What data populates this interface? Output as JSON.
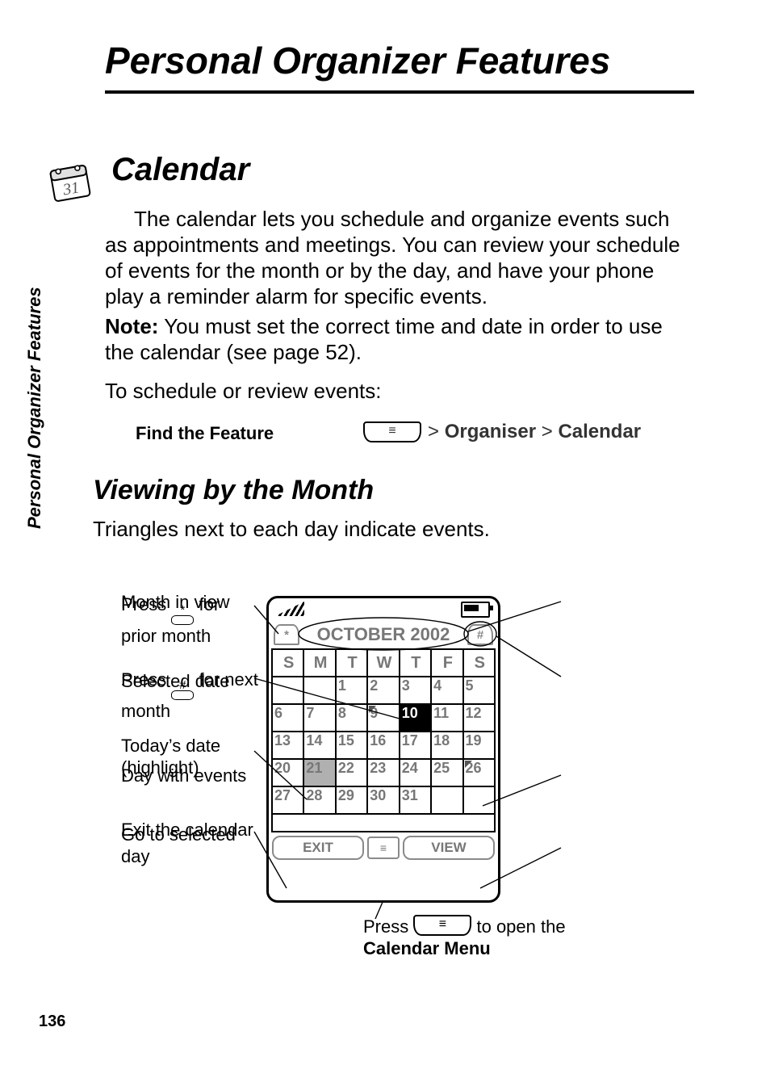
{
  "page": {
    "title": "Personal Organizer Features",
    "side_tab": "Personal Organizer Features",
    "page_number": "136"
  },
  "sections": {
    "calendar_heading": "Calendar",
    "intro": "The calendar lets you schedule and organize events such as appointments and meetings. You can review your schedule of events for the month or by the day, and have your phone play a reminder alarm for specific events.",
    "note_label": "Note:",
    "note_text": " You must set the correct time and date in order to use the calendar (see page 52).",
    "schedule_line": "To schedule or review events:",
    "ftf_label": "Find the Feature",
    "ftf_path_sep1": "> ",
    "ftf_path_item1": "Organiser",
    "ftf_path_sep2": " > ",
    "ftf_path_item2": "Calendar",
    "view_heading": "Viewing by the Month",
    "view_intro": "Triangles next to each day indicate events."
  },
  "callouts": {
    "prior_month_a": "Press ",
    "prior_month_b": " for prior month",
    "selected_date": "Selected date",
    "todays_date": "Today’s date (highlight)",
    "exit_cal": "Exit the calendar",
    "month_in_view": "Month in view",
    "next_month_a": "Press ",
    "next_month_b": " for next month",
    "day_events": "Day with events",
    "go_selected": "Go to selected day"
  },
  "phone": {
    "month_label": "OCTOBER 2002",
    "nav_prev": "*",
    "nav_next": "#",
    "dow": [
      "S",
      "M",
      "T",
      "W",
      "T",
      "F",
      "S"
    ],
    "weeks": [
      [
        "",
        "",
        "1",
        "2",
        "3",
        "4",
        "5"
      ],
      [
        "6",
        "7",
        "8",
        "9",
        "10",
        "11",
        "12"
      ],
      [
        "13",
        "14",
        "15",
        "16",
        "17",
        "18",
        "19"
      ],
      [
        "20",
        "21",
        "22",
        "23",
        "24",
        "25",
        "26"
      ],
      [
        "27",
        "28",
        "29",
        "30",
        "31",
        "",
        ""
      ]
    ],
    "selected_day": "10",
    "today_day": "21",
    "event_days": [
      "9",
      "26"
    ],
    "soft_left": "EXIT",
    "soft_right": "VIEW"
  },
  "footer_note": {
    "a": "Press ",
    "b": " to open the ",
    "c": "Calendar Menu"
  }
}
